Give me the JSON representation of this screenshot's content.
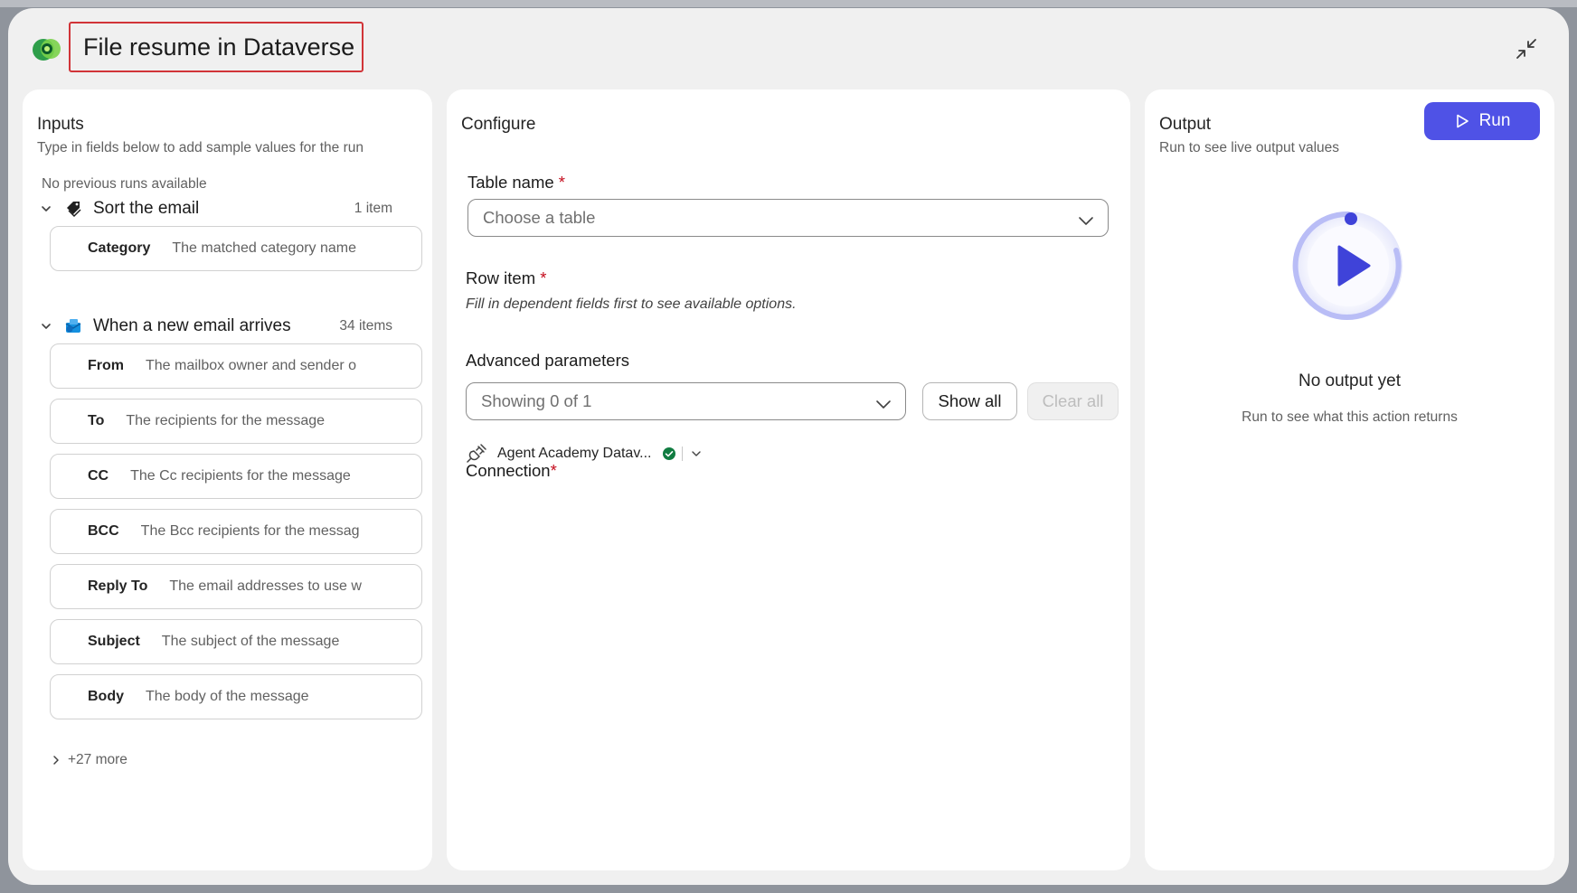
{
  "header": {
    "title": "File resume in Dataverse"
  },
  "icons": {
    "app": "dataverse-logo",
    "collapse": "collapse-arrows-icon",
    "tag": "tag-icon",
    "email": "outlook-email-icon",
    "connection": "plug-icon",
    "status": "green-check-icon",
    "run": "play-icon"
  },
  "inputs": {
    "title": "Inputs",
    "subtitle": "Type in fields below to add sample values for the run",
    "no_previous": "No previous runs available",
    "groups": [
      {
        "name": "Sort the email",
        "count": "1 item",
        "fields": [
          {
            "label": "Category",
            "placeholder": "The matched category name"
          }
        ]
      },
      {
        "name": "When a new email arrives",
        "count": "34 items",
        "fields": [
          {
            "label": "From",
            "placeholder": "The mailbox owner and sender o"
          },
          {
            "label": "To",
            "placeholder": "The recipients for the message"
          },
          {
            "label": "CC",
            "placeholder": "The Cc recipients for the message"
          },
          {
            "label": "BCC",
            "placeholder": "The Bcc recipients for the messag"
          },
          {
            "label": "Reply To",
            "placeholder": "The email addresses to use w"
          },
          {
            "label": "Subject",
            "placeholder": "The subject of the message"
          },
          {
            "label": "Body",
            "placeholder": "The body of the message"
          }
        ]
      }
    ],
    "more": "+27 more"
  },
  "configure": {
    "title": "Configure",
    "table_name_label": "Table name",
    "required_mark": "*",
    "table_name_placeholder": "Choose a table",
    "row_item_label": "Row item",
    "row_item_hint": "Fill in dependent fields first to see available options.",
    "advanced_label": "Advanced parameters",
    "advanced_value": "Showing 0 of 1",
    "show_all": "Show all",
    "clear_all": "Clear all",
    "connection_label": "Connection",
    "connection_name": "Agent Academy Datav..."
  },
  "output": {
    "title": "Output",
    "subtitle": "Run to see live output values",
    "run_label": "Run",
    "empty_title": "No output yet",
    "empty_sub": "Run to see what this action returns"
  },
  "colors": {
    "accent": "#4f52e6",
    "required": "#c50f1f",
    "highlight_border": "#d13438",
    "success": "#107c41"
  }
}
